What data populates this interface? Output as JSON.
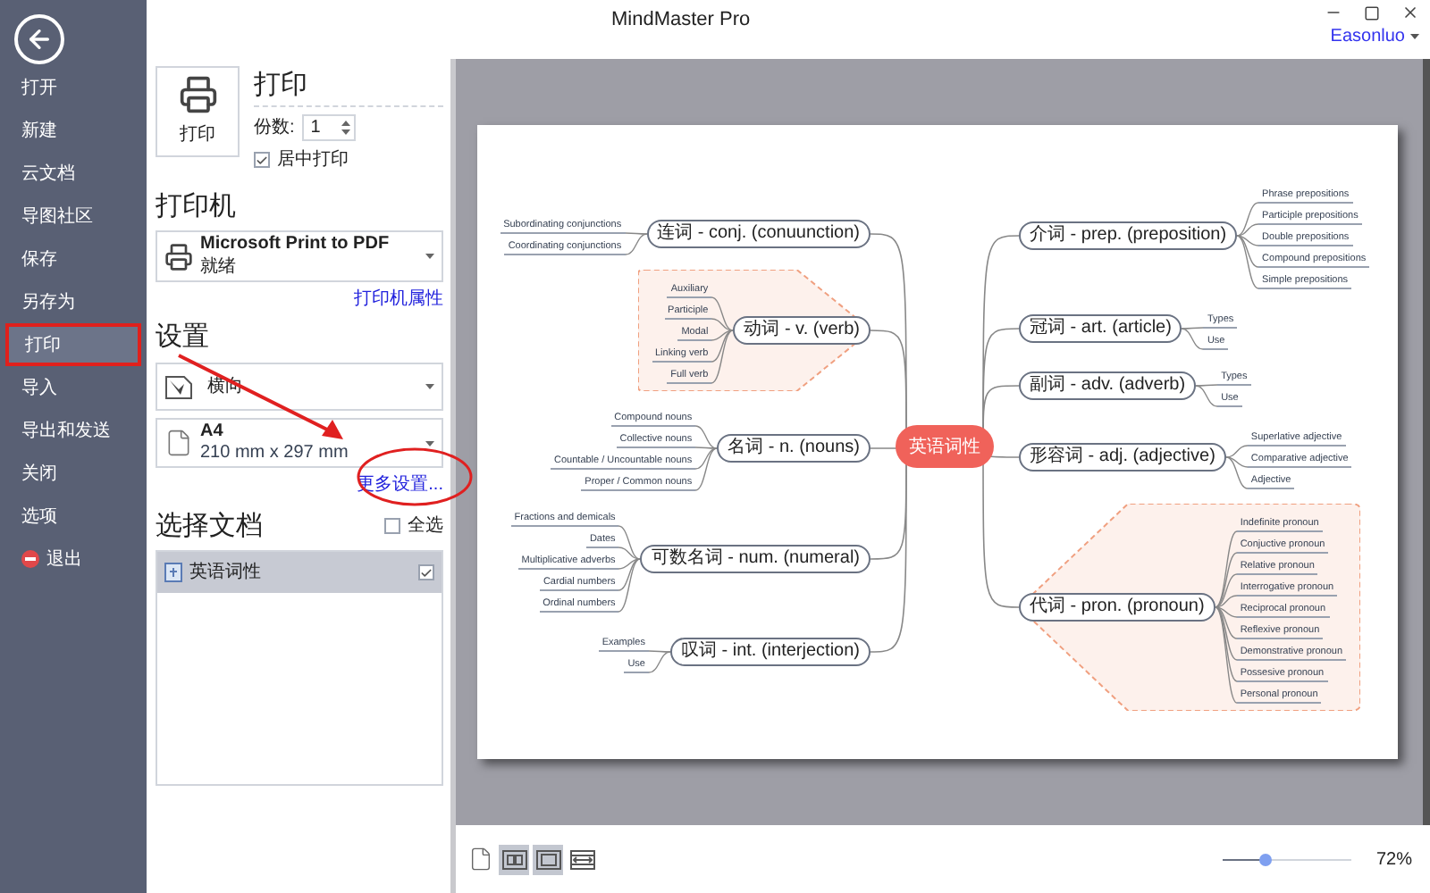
{
  "window": {
    "title": "MindMaster Pro",
    "user": "Easonluo"
  },
  "sidebar": {
    "items": [
      {
        "label": "打开",
        "kind": "text",
        "selected": false
      },
      {
        "label": "新建",
        "kind": "text",
        "selected": false
      },
      {
        "label": "云文档",
        "kind": "text",
        "selected": false
      },
      {
        "label": "导图社区",
        "kind": "text",
        "selected": false
      },
      {
        "label": "保存",
        "kind": "text",
        "selected": false
      },
      {
        "label": "另存为",
        "kind": "text",
        "selected": false
      },
      {
        "label": "打印",
        "kind": "text",
        "selected": true
      },
      {
        "label": "导入",
        "kind": "text",
        "selected": false
      },
      {
        "label": "导出和发送",
        "kind": "text",
        "selected": false
      },
      {
        "label": "关闭",
        "kind": "text",
        "selected": false
      },
      {
        "label": "选项",
        "kind": "text",
        "selected": false
      },
      {
        "label": "退出",
        "kind": "exit",
        "selected": false
      }
    ]
  },
  "print": {
    "title": "打印",
    "button": "打印",
    "copies_label": "份数:",
    "copies": "1",
    "center_label": "居中打印",
    "center_checked": true
  },
  "printer": {
    "heading": "打印机",
    "name": "Microsoft Print to PDF",
    "status": "就绪",
    "properties_link": "打印机属性"
  },
  "settings": {
    "heading": "设置",
    "orientation": "横向",
    "paper": "A4",
    "paper_size": "210 mm x 297 mm",
    "more_link": "更多设置..."
  },
  "documents": {
    "heading": "选择文档",
    "select_all_label": "全选",
    "select_all_checked": false,
    "items": [
      {
        "name": "英语词性",
        "selected": true,
        "checked": true
      }
    ]
  },
  "mindmap": {
    "central": "英语词性",
    "branches": [
      {
        "label": "连词 - conj. (conuunction)",
        "kind": "left",
        "boundary": false,
        "leaves": [
          "Subordinating conjunctions",
          "Coordinating conjunctions"
        ]
      },
      {
        "label": "动词 - v. (verb)",
        "kind": "left",
        "boundary": true,
        "leaves": [
          "Auxiliary",
          "Participle",
          "Modal",
          "Linking verb",
          "Full verb"
        ]
      },
      {
        "label": "名词 - n. (nouns)",
        "kind": "left",
        "boundary": false,
        "leaves": [
          "Compound nouns",
          "Collective nouns",
          "Countable / Uncountable nouns",
          "Proper / Common nouns"
        ]
      },
      {
        "label": "可数名词 - num. (numeral)",
        "kind": "left",
        "boundary": false,
        "leaves": [
          "Fractions and demicals",
          "Dates",
          "Multiplicative adverbs",
          "Cardial numbers",
          "Ordinal numbers"
        ]
      },
      {
        "label": "叹词 - int. (interjection)",
        "kind": "left",
        "boundary": false,
        "leaves": [
          "Examples",
          "Use"
        ]
      },
      {
        "label": "介词 - prep. (preposition)",
        "kind": "right",
        "boundary": false,
        "leaves": [
          "Phrase prepositions",
          "Participle prepositions",
          "Double prepositions",
          "Compound prepositions",
          "Simple prepositions"
        ]
      },
      {
        "label": "冠词 - art. (article)",
        "kind": "right",
        "boundary": false,
        "leaves": [
          "Types",
          "Use"
        ]
      },
      {
        "label": "副词 - adv. (adverb)",
        "kind": "right",
        "boundary": false,
        "leaves": [
          "Types",
          "Use"
        ]
      },
      {
        "label": "形容词 - adj. (adjective)",
        "kind": "right",
        "boundary": false,
        "leaves": [
          "Superlative adjective",
          "Comparative adjective",
          "Adjective"
        ]
      },
      {
        "label": "代词 - pron. (pronoun)",
        "kind": "right",
        "boundary": true,
        "leaves": [
          "Indefinite pronoun",
          "Conjuctive pronoun",
          "Relative pronoun",
          "Interrogative pronoun",
          "Reciprocal pronoun",
          "Reflexive pronoun",
          "Demonstrative pronoun",
          "Possesive pronoun",
          "Personal pronoun"
        ]
      }
    ]
  },
  "view_buttons": [
    {
      "kind": "page",
      "selected": false
    },
    {
      "kind": "two-page",
      "selected": true
    },
    {
      "kind": "single",
      "selected": true
    },
    {
      "kind": "fit-width",
      "selected": false
    }
  ],
  "zoom": {
    "level": 0.33,
    "reading": "72%"
  }
}
